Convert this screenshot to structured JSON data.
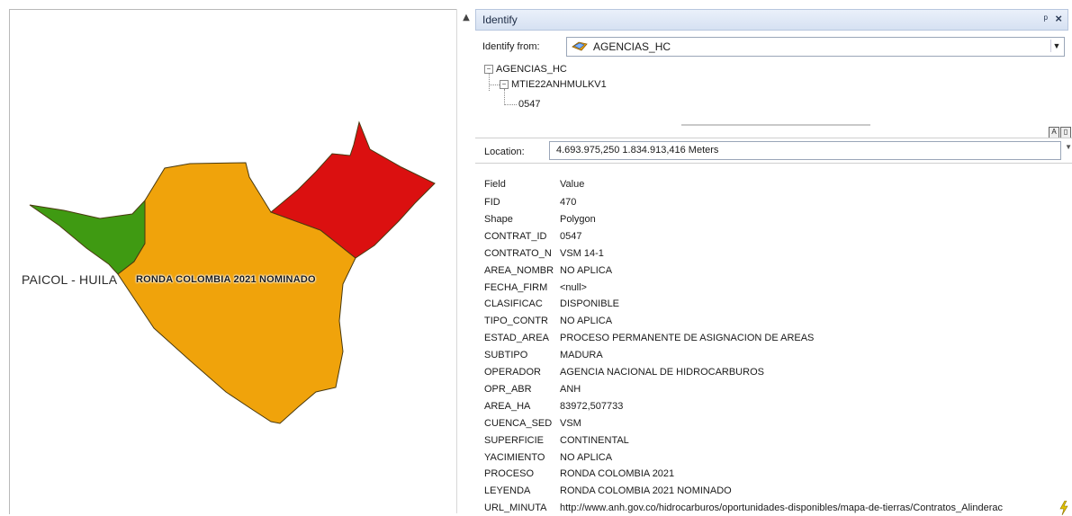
{
  "map": {
    "labels": {
      "paicol": "PAICOL - HUILA",
      "ronda": "RONDA COLOMBIA 2021 NOMINADO"
    },
    "colors": {
      "green_area": "#3f9a12",
      "orange_area": "#f0a30b",
      "red_area": "#db1010",
      "outline": "#4a3a10"
    }
  },
  "identify": {
    "title": "Identify",
    "identify_from_label": "Identify from:",
    "identify_from_value": "AGENCIAS_HC",
    "tree": {
      "root": "AGENCIAS_HC",
      "child": "MTIE22ANHMULKV1",
      "leaf": "0547"
    },
    "location_label": "Location:",
    "location_value": "4.693.975,250  1.834.913,416 Meters",
    "grid_header": {
      "field": "Field",
      "value": "Value"
    },
    "rows": [
      {
        "field": "FID",
        "value": "470"
      },
      {
        "field": "Shape",
        "value": "Polygon"
      },
      {
        "field": "CONTRAT_ID",
        "value": "0547"
      },
      {
        "field": "CONTRATO_N",
        "value": "VSM 14-1"
      },
      {
        "field": "AREA_NOMBR",
        "value": "NO APLICA"
      },
      {
        "field": "FECHA_FIRM",
        "value": "<null>"
      },
      {
        "field": "CLASIFICAC",
        "value": "DISPONIBLE"
      },
      {
        "field": "TIPO_CONTR",
        "value": "NO APLICA"
      },
      {
        "field": "ESTAD_AREA",
        "value": "PROCESO PERMANENTE DE ASIGNACION DE AREAS"
      },
      {
        "field": "SUBTIPO",
        "value": "MADURA"
      },
      {
        "field": "OPERADOR",
        "value": "AGENCIA NACIONAL DE HIDROCARBUROS"
      },
      {
        "field": "OPR_ABR",
        "value": "ANH"
      },
      {
        "field": "AREA_HA",
        "value": "83972,507733"
      },
      {
        "field": "CUENCA_SED",
        "value": "VSM"
      },
      {
        "field": "SUPERFICIE",
        "value": "CONTINENTAL"
      },
      {
        "field": "YACIMIENTO",
        "value": "NO APLICA"
      },
      {
        "field": "PROCESO",
        "value": "RONDA COLOMBIA 2021"
      },
      {
        "field": "LEYENDA",
        "value": "RONDA COLOMBIA 2021 NOMINADO"
      },
      {
        "field": "URL_MINUTA",
        "value": "http://www.anh.gov.co/hidrocarburos/oportunidades-disponibles/mapa-de-tierras/Contratos_Alinderac"
      }
    ]
  }
}
